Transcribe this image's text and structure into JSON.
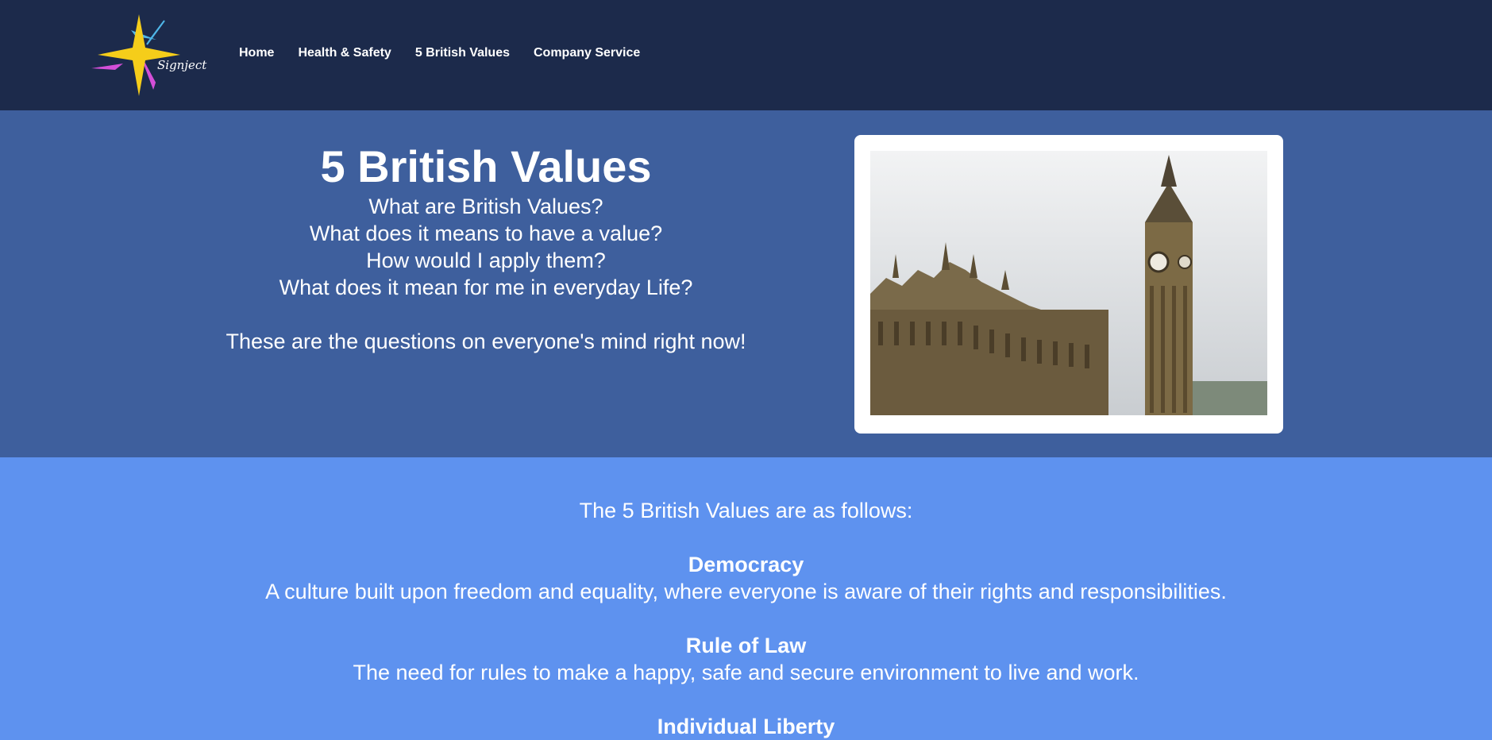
{
  "nav": {
    "logo_text": "Signject",
    "items": [
      {
        "label": "Home"
      },
      {
        "label": "Health & Safety"
      },
      {
        "label": "5 British Values"
      },
      {
        "label": "Company Service"
      }
    ]
  },
  "hero": {
    "title": "5 British Values",
    "questions": [
      "What are British Values?",
      "What does it means to have a value?",
      "How would I apply them?",
      "What does it mean for me in everyday Life?"
    ],
    "tagline": "These are the questions on everyone's mind right now!"
  },
  "values": {
    "intro": "The 5 British Values are as follows:",
    "items": [
      {
        "name": "Democracy",
        "description": "A culture built upon freedom and equality, where everyone is aware of their rights and responsibilities."
      },
      {
        "name": "Rule of Law",
        "description": "The need for rules to make a happy, safe and secure environment to live and work."
      },
      {
        "name": "Individual Liberty",
        "description": ""
      }
    ]
  },
  "colors": {
    "nav_bg": "#1c2a4b",
    "hero_bg": "#3e5f9d",
    "values_bg": "#5e92ef"
  }
}
